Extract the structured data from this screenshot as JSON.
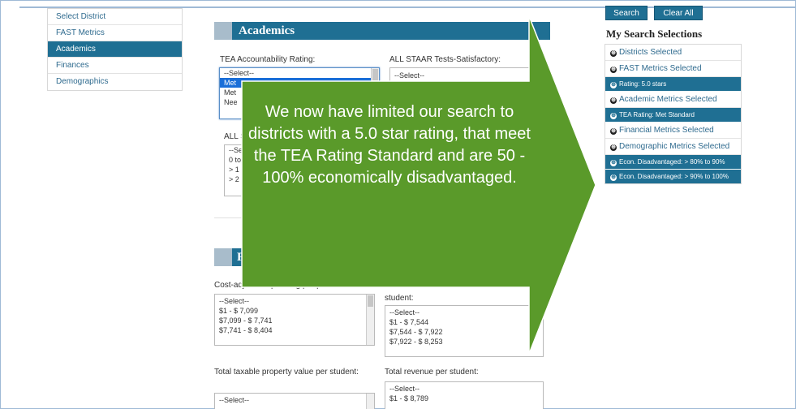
{
  "leftnav": {
    "items": [
      {
        "label": "Select District"
      },
      {
        "label": "FAST Metrics"
      },
      {
        "label": "Academics"
      },
      {
        "label": "Finances"
      },
      {
        "label": "Demographics"
      }
    ]
  },
  "academics": {
    "title": "Academics",
    "tea_label": "TEA Accountability Rating:",
    "tea_options": [
      "--Select--",
      "Met",
      "Met",
      "Nee"
    ],
    "staar_label": "ALL STAAR Tests-Satisfactory:",
    "staar_options": [
      "--Select--"
    ],
    "all_label": "ALL S",
    "all_options": [
      "--Se",
      "0 to",
      "> 1",
      "> 2"
    ]
  },
  "finances": {
    "title": "F",
    "cost_label": "Cost-adjusted operating per pu",
    "cost_options": [
      "--Select--",
      "$1 - $ 7,099",
      "$7,099 - $ 7,741",
      "$7,741 - $ 8,404"
    ],
    "student_label": "student:",
    "student_options": [
      "--Select--",
      "$1 - $ 7,544",
      "$7,544 - $ 7,922",
      "$7,922 - $ 8,253"
    ],
    "taxable_label": "Total taxable property value per student:",
    "taxable_options": [
      "--Select--"
    ],
    "revenue_label": "Total revenue per student:",
    "revenue_options": [
      "--Select--",
      "$1 - $ 8,789"
    ]
  },
  "right": {
    "search_label": "Search",
    "clear_label": "Clear All",
    "title": "My Search Selections",
    "rows": [
      {
        "label": "Districts Selected",
        "filter": false
      },
      {
        "label": "FAST Metrics Selected",
        "filter": false
      },
      {
        "label": "Rating: 5.0 stars",
        "filter": true
      },
      {
        "label": "Academic Metrics Selected",
        "filter": false
      },
      {
        "label": "TEA Rating: Met Standard",
        "filter": true
      },
      {
        "label": "Financial Metrics Selected",
        "filter": false
      },
      {
        "label": "Demographic Metrics Selected",
        "filter": false
      },
      {
        "label": "Econ. Disadvantaged: > 80% to 90%",
        "filter": true
      },
      {
        "label": "Econ. Disadvantaged: > 90% to 100%",
        "filter": true
      }
    ],
    "icon_text": "⊕"
  },
  "callout": {
    "text": "We now have limited our search to districts with a 5.0 star rating, that meet the TEA Rating Standard and are 50 - 100% economically disadvantaged.",
    "color": "#5a9a2a"
  }
}
